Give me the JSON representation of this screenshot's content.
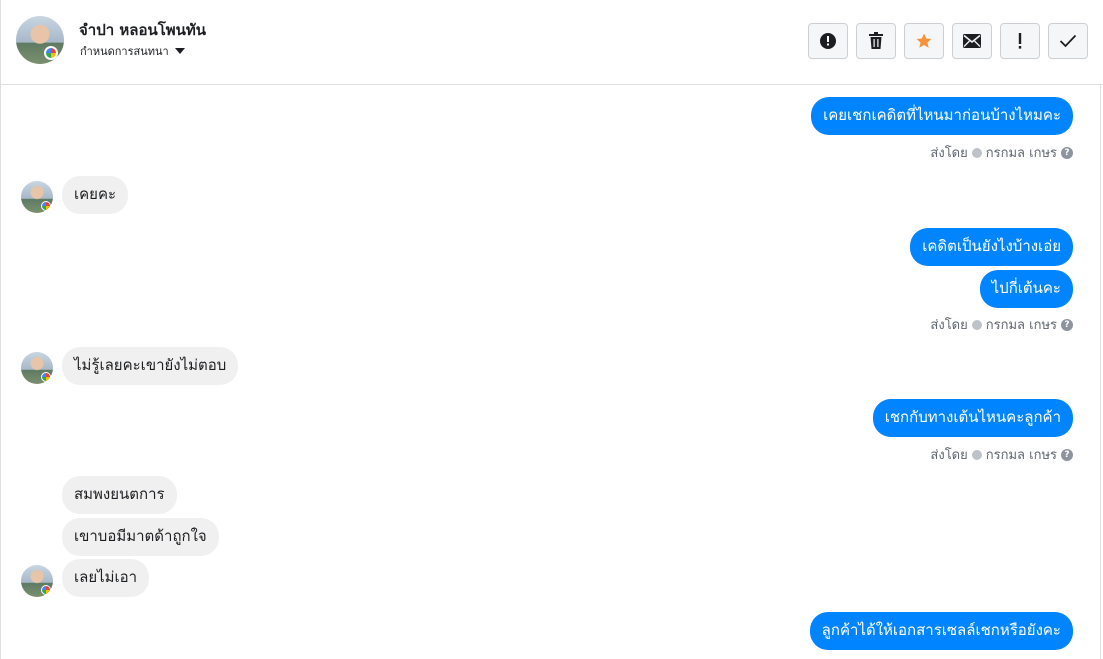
{
  "header": {
    "contact_name": "จำปา หลอนโพนทัน",
    "assign_label": "กำหนดการสนทนา",
    "tools": [
      {
        "icon": "alert-circle-icon"
      },
      {
        "icon": "trash-icon"
      },
      {
        "icon": "star-icon",
        "color": "#f7923a"
      },
      {
        "icon": "envelope-icon"
      },
      {
        "icon": "exclamation-icon"
      },
      {
        "icon": "check-icon"
      }
    ]
  },
  "colors": {
    "outgoing_bubble": "#0084ff",
    "incoming_bubble": "#f1f0f0",
    "meta_text": "#606770"
  },
  "messages": [
    {
      "dir": "out",
      "text": "เคยเชกเคดิตที่ไหนมาก่อนบ้างไหมคะ"
    },
    {
      "meta": "ส่งโดย",
      "sender": "กรกมล เกษร"
    },
    {
      "dir": "in",
      "text": "เคยคะ"
    },
    {
      "dir": "out",
      "text": "เคดิตเป็นยังไงบ้างเอ่ย"
    },
    {
      "dir": "out",
      "text": "ไปกี่เต้นคะ"
    },
    {
      "meta": "ส่งโดย",
      "sender": "กรกมล เกษร"
    },
    {
      "dir": "in",
      "text": "ไม่รู้เลยคะเขายังไม่ตอบ"
    },
    {
      "dir": "out",
      "text": "เชกกับทางเต้นไหนคะลูกค้า"
    },
    {
      "meta": "ส่งโดย",
      "sender": "กรกมล เกษร"
    },
    {
      "dir": "in",
      "text": "สมพงยนตการ"
    },
    {
      "dir": "in",
      "text": "เขาบอมีมาตด้าถูกใจ"
    },
    {
      "dir": "in",
      "text": "เลยไม่เอา"
    },
    {
      "dir": "out",
      "text": "ลูกค้าได้ให้เอกสารเซลล์เชกหรือยังคะ"
    }
  ]
}
